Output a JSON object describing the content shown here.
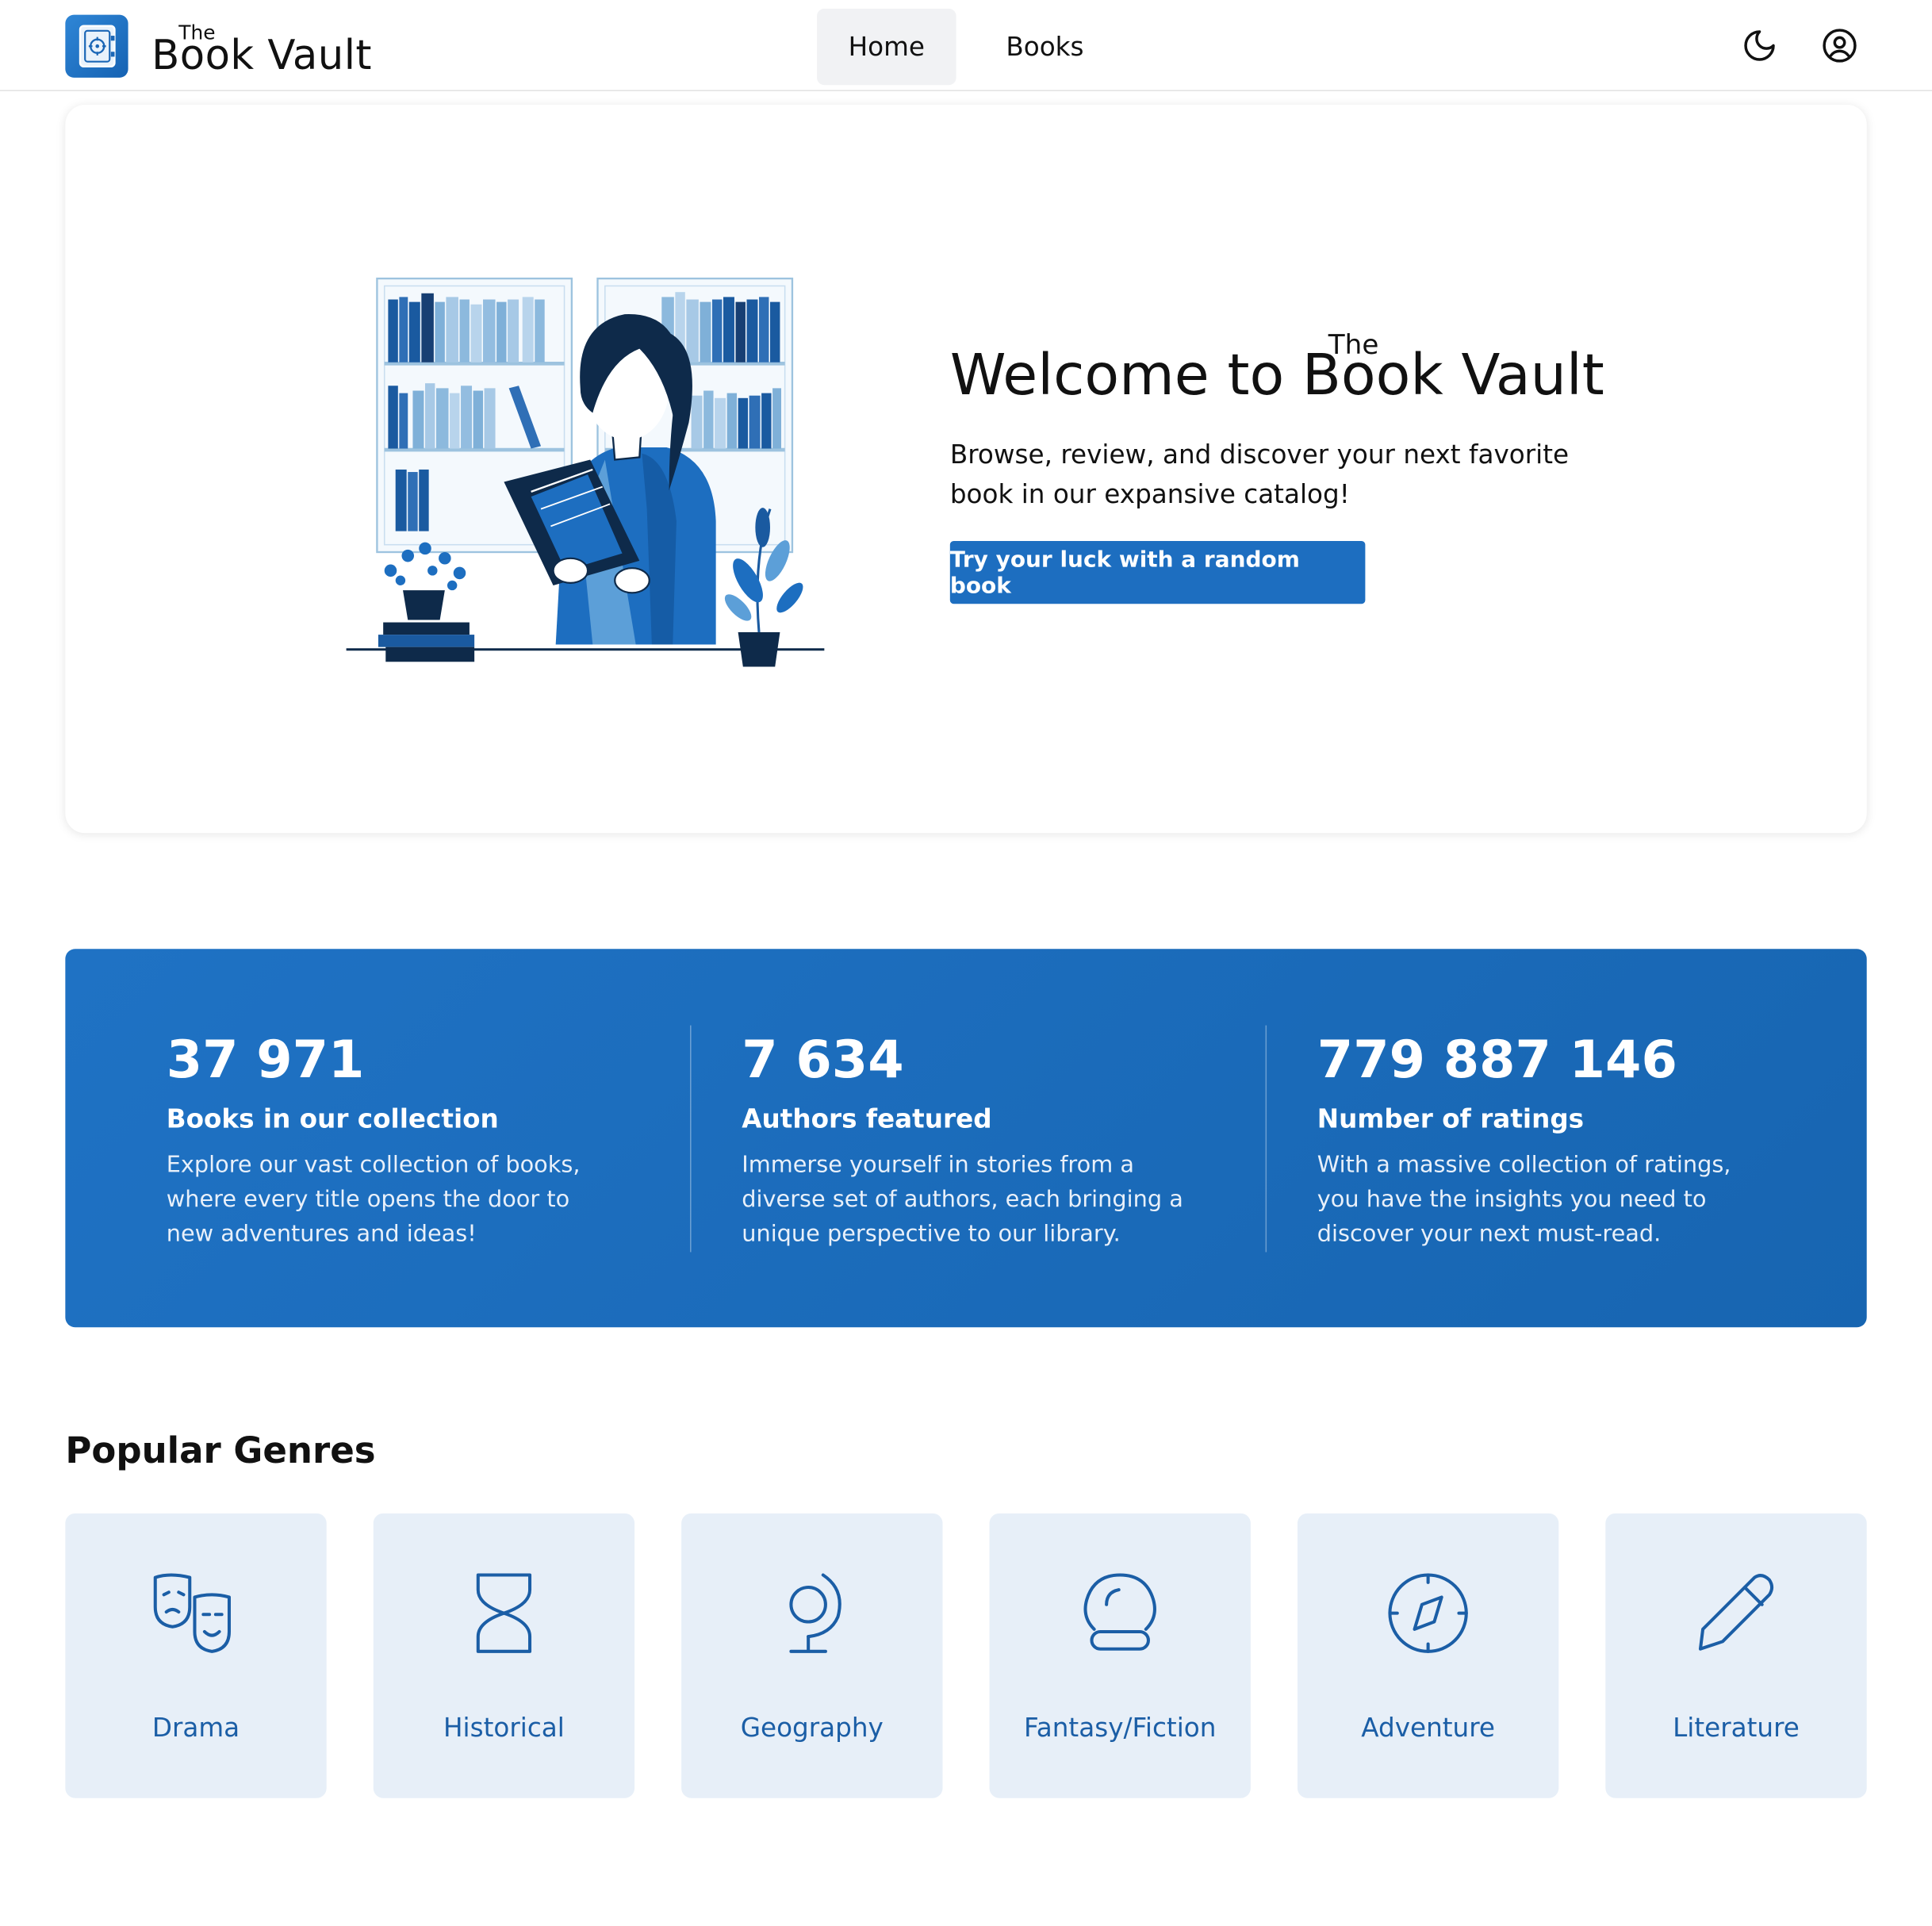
{
  "header": {
    "brand_the": "The",
    "brand_name": "Book Vault",
    "nav": {
      "home": "Home",
      "books": "Books"
    },
    "icons": {
      "theme_toggle": "moon-icon",
      "account": "user-circle-icon",
      "logo": "safe-vault-icon"
    }
  },
  "hero": {
    "title_the": "The",
    "title": "Welcome to Book Vault",
    "subtitle": "Browse, review, and discover your next favorite book in our expansive catalog!",
    "cta": "Try your luck with a random book",
    "illustration": "woman-reading-book-illustration"
  },
  "stats": [
    {
      "value": "37 971",
      "label": "Books in our collection",
      "description": "Explore our vast collection of books, where every title opens the door to new adventures and ideas!"
    },
    {
      "value": "7 634",
      "label": "Authors featured",
      "description": "Immerse yourself in stories from a diverse set of authors, each bringing a unique perspective to our library."
    },
    {
      "value": "779 887 146",
      "label": "Number of ratings",
      "description": "With a massive collection of ratings, you have the insights you need to discover your next must-read."
    }
  ],
  "genres": {
    "title": "Popular Genres",
    "items": [
      {
        "label": "Drama",
        "icon": "theater-masks-icon"
      },
      {
        "label": "Historical",
        "icon": "hourglass-icon"
      },
      {
        "label": "Geography",
        "icon": "globe-icon"
      },
      {
        "label": "Fantasy/Fiction",
        "icon": "crystal-ball-icon"
      },
      {
        "label": "Adventure",
        "icon": "compass-icon"
      },
      {
        "label": "Literature",
        "icon": "pencil-icon"
      }
    ]
  },
  "colors": {
    "primary": "#1d6ec0",
    "stats_bg": "#1f72c4",
    "genre_card_bg": "#e7eff8",
    "genre_text": "#1b5ea6",
    "nav_active_bg": "#f1f2f4"
  }
}
